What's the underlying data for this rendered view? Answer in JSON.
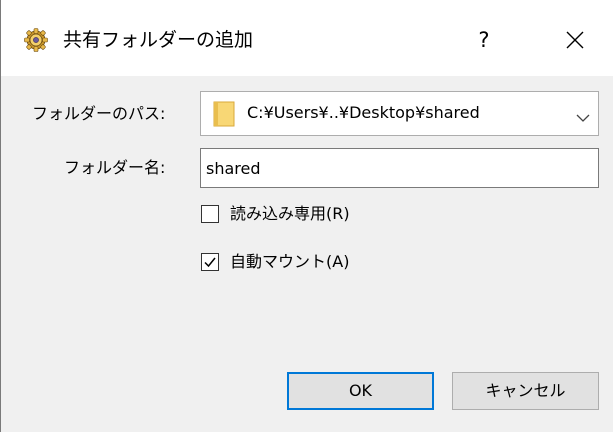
{
  "window": {
    "title": "共有フォルダーの追加",
    "help_label": "?",
    "icon": "virtualbox-gear-icon"
  },
  "form": {
    "folder_path_label": "フォルダーのパス:",
    "folder_path_value": "C:¥Users¥..¥Desktop¥shared",
    "folder_name_label": "フォルダー名:",
    "folder_name_value": "shared",
    "read_only_label": "読み込み専用(R)",
    "read_only_checked": false,
    "auto_mount_label": "自動マウント(A)",
    "auto_mount_checked": true
  },
  "buttons": {
    "ok_label": "OK",
    "cancel_label": "キャンセル"
  },
  "colors": {
    "accent": "#0078d7",
    "folder": "#f8d775"
  }
}
